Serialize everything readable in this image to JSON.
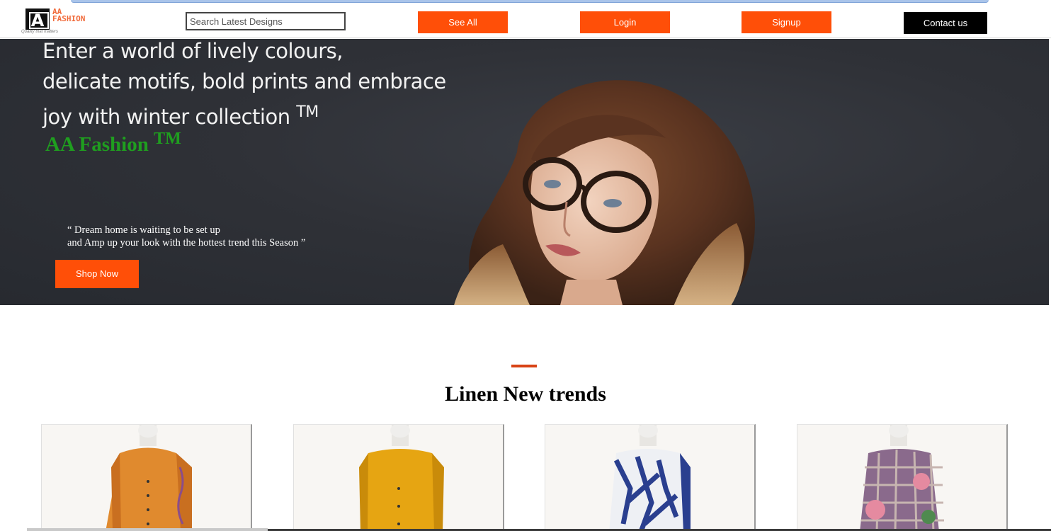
{
  "header": {
    "logo_text_line1": "AA",
    "logo_text_line2": "FASHION",
    "logo_tagline": "Quality that matters",
    "search_placeholder": "Search Latest Designs",
    "see_all_label": "See All",
    "login_label": "Login",
    "signup_label": "Signup",
    "contact_label": "Contact us"
  },
  "hero": {
    "headline_line1": "Enter a world of lively colours,",
    "headline_line2": "delicate motifs, bold prints and embrace",
    "headline_line3": "joy with winter collection",
    "headline_tm": "TM",
    "brand": "AA Fashion",
    "brand_tm": "TM",
    "quote_line1": "“ Dream home is waiting to be set up",
    "quote_line2": "and Amp up your look with the hottest trend this Season ”",
    "shop_label": "Shop Now"
  },
  "section": {
    "title": "Linen New trends",
    "products": [
      {
        "color": "#e08a2e",
        "accent": "#c96f20"
      },
      {
        "color": "#e6a512",
        "accent": "#c98b0a"
      },
      {
        "color": "#2a3f8f",
        "accent": "#f0f0f0"
      },
      {
        "color": "#8a6a8c",
        "accent": "#e58aa0"
      }
    ]
  },
  "colors": {
    "accent": "#ff4f08",
    "brand_green": "#1f9e1f",
    "hero_bg": "#2f3137"
  }
}
